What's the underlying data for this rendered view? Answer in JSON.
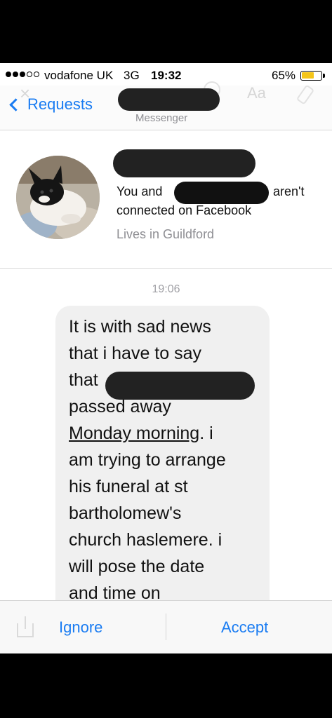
{
  "status_bar": {
    "carrier": "vodafone UK",
    "network": "3G",
    "time": "19:32",
    "battery_percent": "65%",
    "battery_level": 0.65,
    "signal_bars_filled": 3,
    "signal_bars_total": 5
  },
  "nav": {
    "back_label": "Requests",
    "subtitle": "Messenger"
  },
  "profile": {
    "connection_prefix": "You and",
    "connection_suffix": "aren't",
    "connection_line2": "connected on Facebook",
    "location": "Lives in Guildford"
  },
  "conversation": {
    "timestamp": "19:06",
    "message_lines": [
      "It is with sad news",
      "that i have to say",
      "that",
      "passed away",
      "Monday morning",
      ". i",
      "am trying to arrange",
      "his funeral at st",
      "bartholomew's",
      "church haslemere. i",
      "will pose the date",
      "and time on"
    ]
  },
  "actions": {
    "ignore_label": "Ignore",
    "accept_label": "Accept"
  },
  "colors": {
    "accent": "#1a7cf2",
    "battery": "#f5c518",
    "bubble": "#f0f0f0"
  }
}
